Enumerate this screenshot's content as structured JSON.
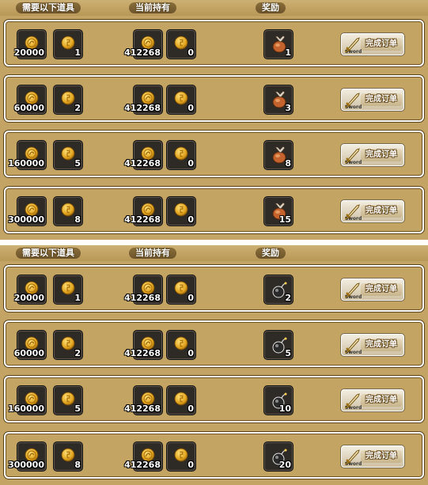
{
  "panels": [
    {
      "headers": {
        "required": "需要以下道具",
        "current": "当前持有",
        "reward": "奖励"
      },
      "reward_icon": "meat-bag-icon",
      "rows": [
        {
          "req_a": "20000",
          "req_b": "1",
          "have_a": "412268",
          "have_b": "0",
          "reward": "1",
          "button": "完成订单",
          "button_tag": "Sword"
        },
        {
          "req_a": "60000",
          "req_b": "2",
          "have_a": "412268",
          "have_b": "0",
          "reward": "3",
          "button": "完成订单",
          "button_tag": "Sword"
        },
        {
          "req_a": "160000",
          "req_b": "5",
          "have_a": "412268",
          "have_b": "0",
          "reward": "8",
          "button": "完成订单",
          "button_tag": "Sword"
        },
        {
          "req_a": "300000",
          "req_b": "8",
          "have_a": "412268",
          "have_b": "0",
          "reward": "15",
          "button": "完成订单",
          "button_tag": "Sword"
        }
      ]
    },
    {
      "headers": {
        "required": "需要以下道具",
        "current": "当前持有",
        "reward": "奖励"
      },
      "reward_icon": "bomb-icon",
      "rows": [
        {
          "req_a": "20000",
          "req_b": "1",
          "have_a": "412268",
          "have_b": "0",
          "reward": "2",
          "button": "完成订单",
          "button_tag": "Sword"
        },
        {
          "req_a": "60000",
          "req_b": "2",
          "have_a": "412268",
          "have_b": "0",
          "reward": "5",
          "button": "完成订单",
          "button_tag": "Sword"
        },
        {
          "req_a": "160000",
          "req_b": "5",
          "have_a": "412268",
          "have_b": "0",
          "reward": "10",
          "button": "完成订单",
          "button_tag": "Sword"
        },
        {
          "req_a": "300000",
          "req_b": "8",
          "have_a": "412268",
          "have_b": "0",
          "reward": "20",
          "button": "完成订单",
          "button_tag": "Sword"
        }
      ]
    }
  ],
  "colors": {
    "panel": "#c3a464",
    "slot": "#2e2a26",
    "row_border": "#ffffff"
  }
}
